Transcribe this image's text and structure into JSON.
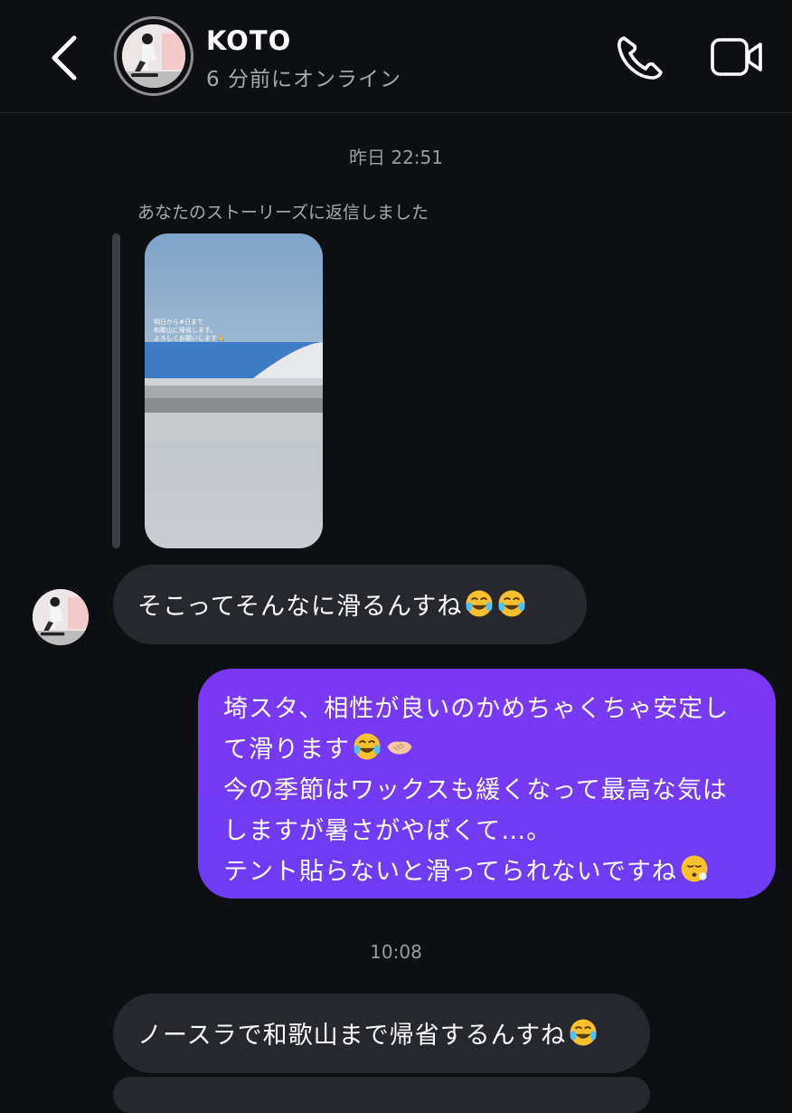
{
  "header": {
    "name": "KOTO",
    "status": "6 分前にオンライン"
  },
  "thread": {
    "timestamp_1": "昨日 22:51",
    "story_reply_note": "あなたのストーリーズに返信しました",
    "story_caption": "明日から#日まで\n和歌山に帰省します。\nよろしくお願いします🙏",
    "msg_in_1": "そこってそんなに滑るんすね",
    "msg_out_lines": [
      "埼スタ、相性が良いのかめちゃくちゃ安定し",
      "て滑ります",
      "今の季節はワックスも緩くなって最高な気は",
      "しますが暑さがやばくて…。",
      "テント貼らないと滑ってられないですね"
    ],
    "timestamp_2": "10:08",
    "msg_in_2": "ノースラで和歌山まで帰省するんすね"
  },
  "icons": {
    "back": "chevron-left-icon",
    "call": "phone-icon",
    "video": "video-camera-icon",
    "laugh": "face-with-tears-of-joy-icon",
    "handshake": "handshake-icon",
    "tired": "weary-face-icon"
  },
  "colors": {
    "background": "#0e0f13",
    "incoming_bubble": "#26282e",
    "outgoing_bubble": "#7b38f4"
  }
}
